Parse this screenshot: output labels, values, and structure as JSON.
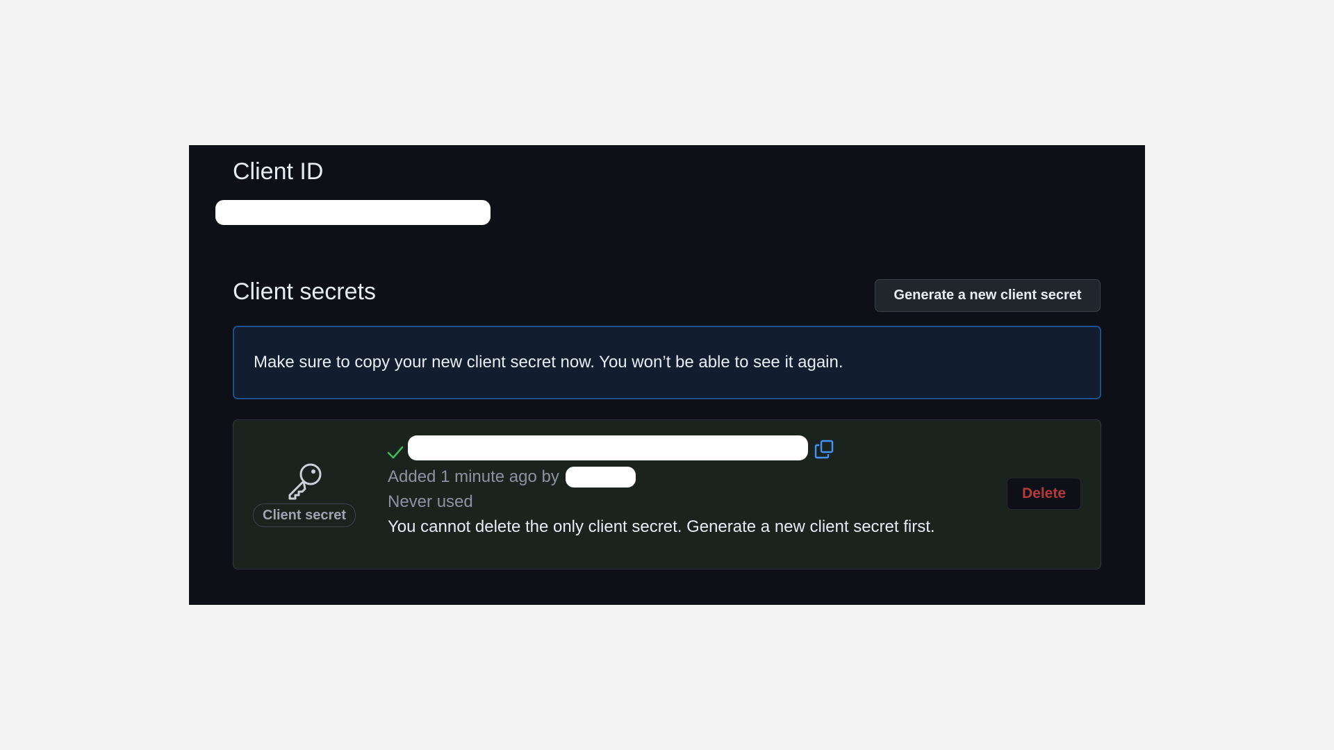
{
  "client_id": {
    "heading": "Client ID"
  },
  "client_secrets": {
    "heading": "Client secrets",
    "generate_button_label": "Generate a new client secret",
    "flash_message": "Make sure to copy your new client secret now. You won’t be able to see it again."
  },
  "secret_item": {
    "type_label": "Client secret",
    "added_text": "Added 1 minute ago by",
    "usage_text": "Never used",
    "delete_notice": "You cannot delete the only client secret. Generate a new client secret first.",
    "delete_button_label": "Delete",
    "icons": {
      "type": "key-icon",
      "status": "check-icon",
      "copy": "copy-icon"
    }
  },
  "colors": {
    "panel_background": "#0d1117",
    "flash_background": "#121d2f",
    "flash_border": "#1f4e8c",
    "secret_box_background": "#1b231f",
    "success": "#3fb950",
    "accent_blue": "#4493f8",
    "danger": "#b6393a",
    "text_primary": "#e6edf3",
    "text_muted": "#8b949e"
  }
}
